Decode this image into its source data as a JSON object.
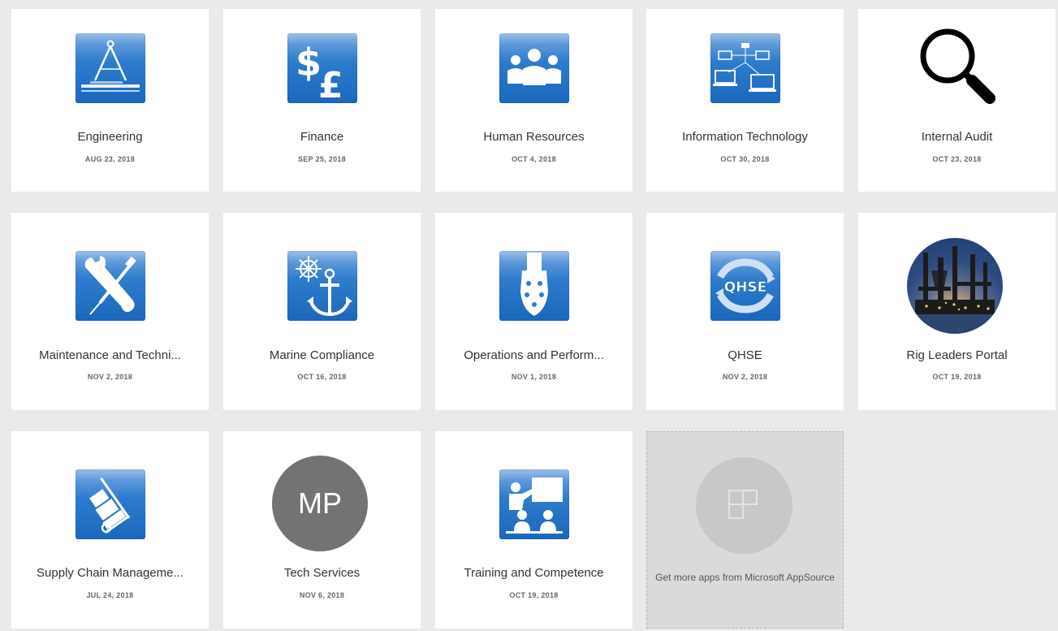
{
  "tiles": [
    {
      "name": "Engineering",
      "date": "AUG 23, 2018",
      "icon": "compass-icon"
    },
    {
      "name": "Finance",
      "date": "SEP 25, 2018",
      "icon": "currency-icon"
    },
    {
      "name": "Human Resources",
      "date": "OCT 4, 2018",
      "icon": "people-icon"
    },
    {
      "name": "Information Technology",
      "date": "OCT 30, 2018",
      "icon": "network-icon"
    },
    {
      "name": "Internal Audit",
      "date": "OCT 23, 2018",
      "icon": "magnifier-icon"
    },
    {
      "name": "Maintenance and Techni...",
      "date": "NOV 2, 2018",
      "icon": "tools-icon"
    },
    {
      "name": "Marine Compliance",
      "date": "OCT 16, 2018",
      "icon": "anchor-wheel-icon"
    },
    {
      "name": "Operations and Perform...",
      "date": "NOV 1, 2018",
      "icon": "drill-bit-icon"
    },
    {
      "name": "QHSE",
      "date": "NOV 2, 2018",
      "icon": "qhse-icon",
      "icon_text": "QHSE"
    },
    {
      "name": "Rig Leaders Portal",
      "date": "OCT 19, 2018",
      "icon": "oil-rig-photo"
    },
    {
      "name": "Supply Chain Manageme...",
      "date": "JUL 24, 2018",
      "icon": "hand-truck-icon"
    },
    {
      "name": "Tech Services",
      "date": "NOV 6, 2018",
      "icon": "initials-avatar",
      "initials": "MP"
    },
    {
      "name": "Training and Competence",
      "date": "OCT 19, 2018",
      "icon": "training-icon"
    }
  ],
  "appsource": {
    "text": "Get more apps from Microsoft AppSource",
    "icon": "add-apps-icon"
  },
  "colors": {
    "background": "#eaeaea",
    "tile": "#ffffff",
    "icon_blue": "#1a67bd",
    "avatar_gray": "#737373"
  }
}
